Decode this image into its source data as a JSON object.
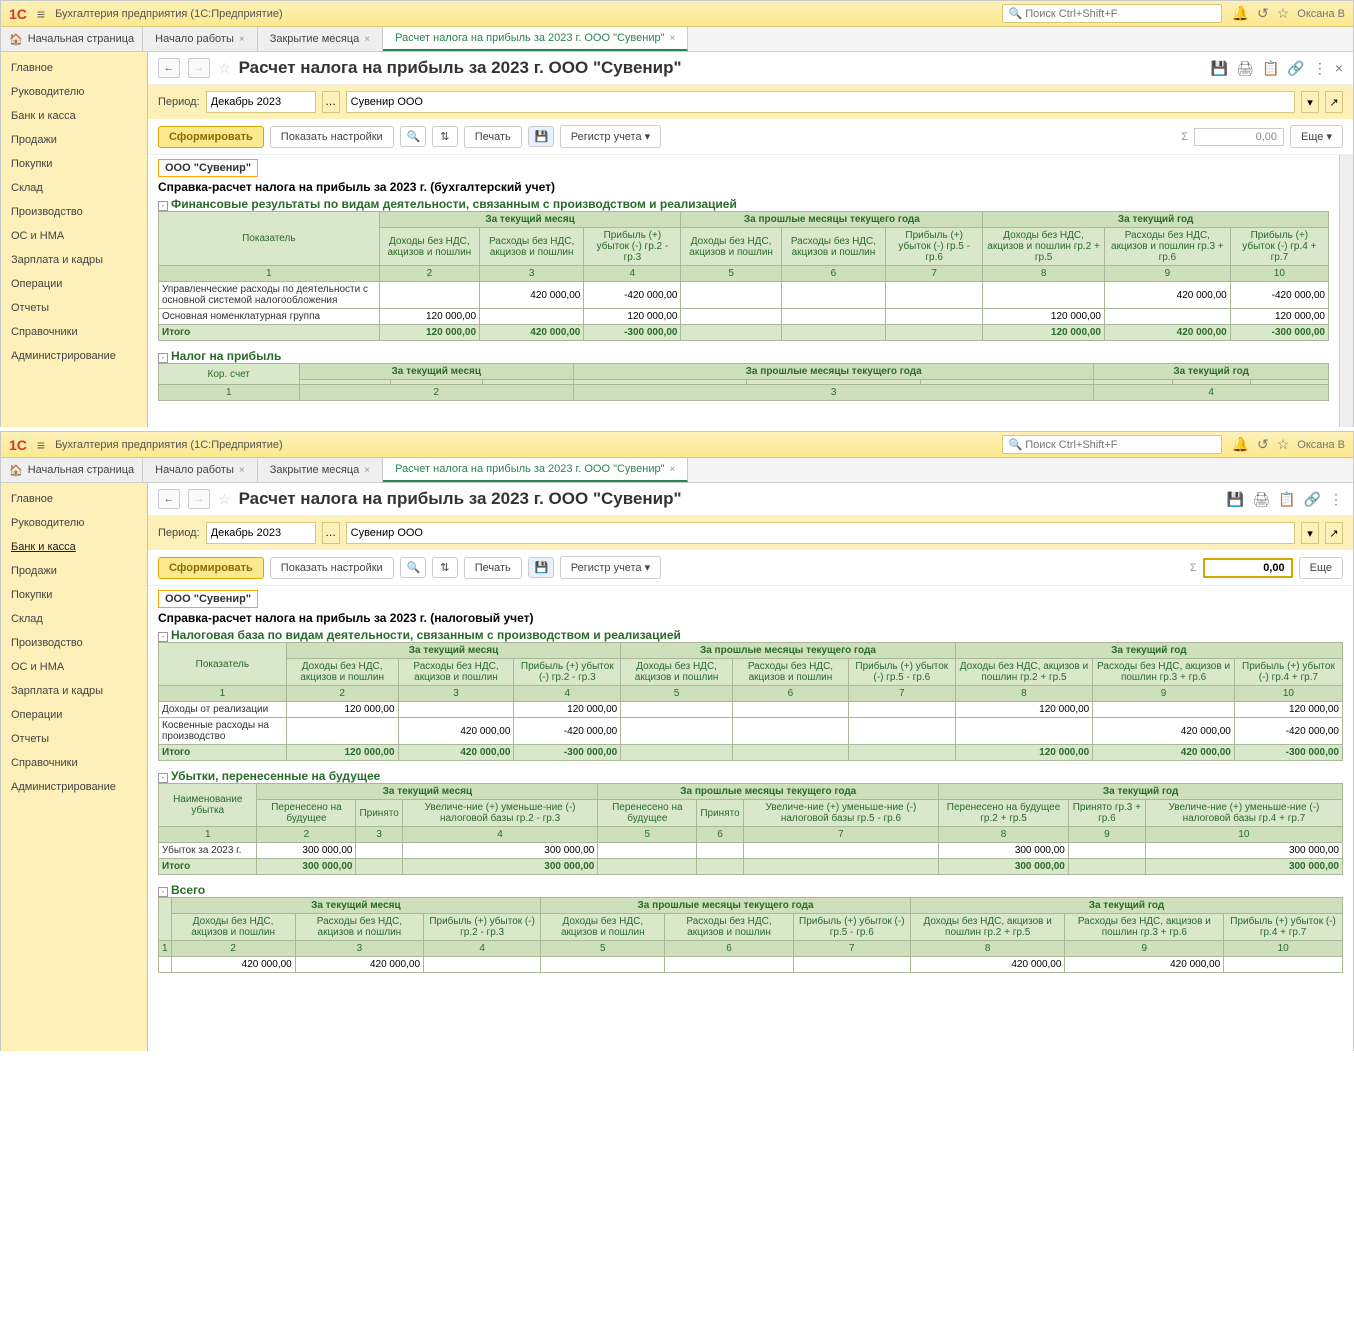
{
  "app_title": "Бухгалтерия предприятия  (1С:Предприятие)",
  "search_placeholder": "Поиск Ctrl+Shift+F",
  "user": "Оксана В",
  "tabs": {
    "home": "Начальная страница",
    "t1": "Начало работы",
    "t2": "Закрытие месяца",
    "t3": "Расчет налога на прибыль за 2023 г. ООО \"Сувенир\""
  },
  "sidebar": [
    "Главное",
    "Руководителю",
    "Банк и касса",
    "Продажи",
    "Покупки",
    "Склад",
    "Производство",
    "ОС и НМА",
    "Зарплата и кадры",
    "Операции",
    "Отчеты",
    "Справочники",
    "Администрирование"
  ],
  "page_title": "Расчет налога на прибыль за 2023 г. ООО \"Сувенир\"",
  "period_label": "Период:",
  "period_value": "Декабрь 2023",
  "org_value": "Сувенир ООО",
  "btn_form": "Сформировать",
  "btn_settings": "Показать настройки",
  "btn_print": "Печать",
  "btn_register": "Регистр учета",
  "btn_more": "Еще",
  "sum_value": "0,00",
  "top_report": {
    "org": "ООО \"Сувенир\"",
    "title": "Справка-расчет налога на прибыль за 2023 г. (бухгалтерский учет)",
    "section1": "Финансовые результаты по видам деятельности, связанным с производством и реализацией",
    "indicator": "Показатель",
    "month": "За текущий месяц",
    "prev": "За прошлые месяцы текущего года",
    "year": "За текущий год",
    "h_income": "Доходы без НДС, акцизов и пошлин",
    "h_expense": "Расходы без НДС, акцизов и пошлин",
    "h_profit1": "Прибыль (+) убыток (-) гр.2 - гр.3",
    "h_profit2": "Прибыль (+) убыток (-) гр.5 - гр.6",
    "h_income3": "Доходы без НДС, акцизов и пошлин гр.2 + гр.5",
    "h_expense3": "Расходы без НДС, акцизов и пошлин гр.3 + гр.6",
    "h_profit3": "Прибыль (+) убыток (-) гр.4 + гр.7",
    "row1_label": "Управленческие расходы по деятельности с основной системой налогообложения",
    "row2_label": "Основная номенклатурная группа",
    "total": "Итого",
    "v_exp": "420 000,00",
    "v_profit_neg": "-420 000,00",
    "v_inc": "120 000,00",
    "v_profit_pos": "120 000,00",
    "v_total_inc": "120 000,00",
    "v_total_exp": "420 000,00",
    "v_total_profit": "-300 000,00",
    "section2": "Налог на прибыль",
    "kor": "Кор. счет"
  },
  "bottom_report": {
    "org": "ООО \"Сувенир\"",
    "title": "Справка-расчет налога на прибыль за 2023 г. (налоговый учет)",
    "section1": "Налоговая база по видам деятельности, связанным с производством и реализацией",
    "row1": "Доходы от реализации",
    "row2": "Косвенные расходы на производство",
    "section2": "Убытки, перенесенные на будущее",
    "loss_name": "Наименование убытка",
    "carried": "Перенесено на будущее",
    "accepted": "Принято",
    "decrease1": "Увеличе-ние (+) уменьше-ние (-) налоговой базы гр.2 - гр.3",
    "decrease2": "Увеличе-ние (+) уменьше-ние (-) налоговой базы гр.5 - гр.6",
    "carried2": "Перенесено на будущее гр.2 + гр.5",
    "accepted2": "Принято гр.3 + гр.6",
    "decrease3": "Увеличе-ние (+) уменьше-ние (-) налоговой базы гр.4 + гр.7",
    "loss_row": "Убыток за 2023 г.",
    "v300": "300 000,00",
    "section3": "Всего",
    "v420": "420 000,00"
  }
}
